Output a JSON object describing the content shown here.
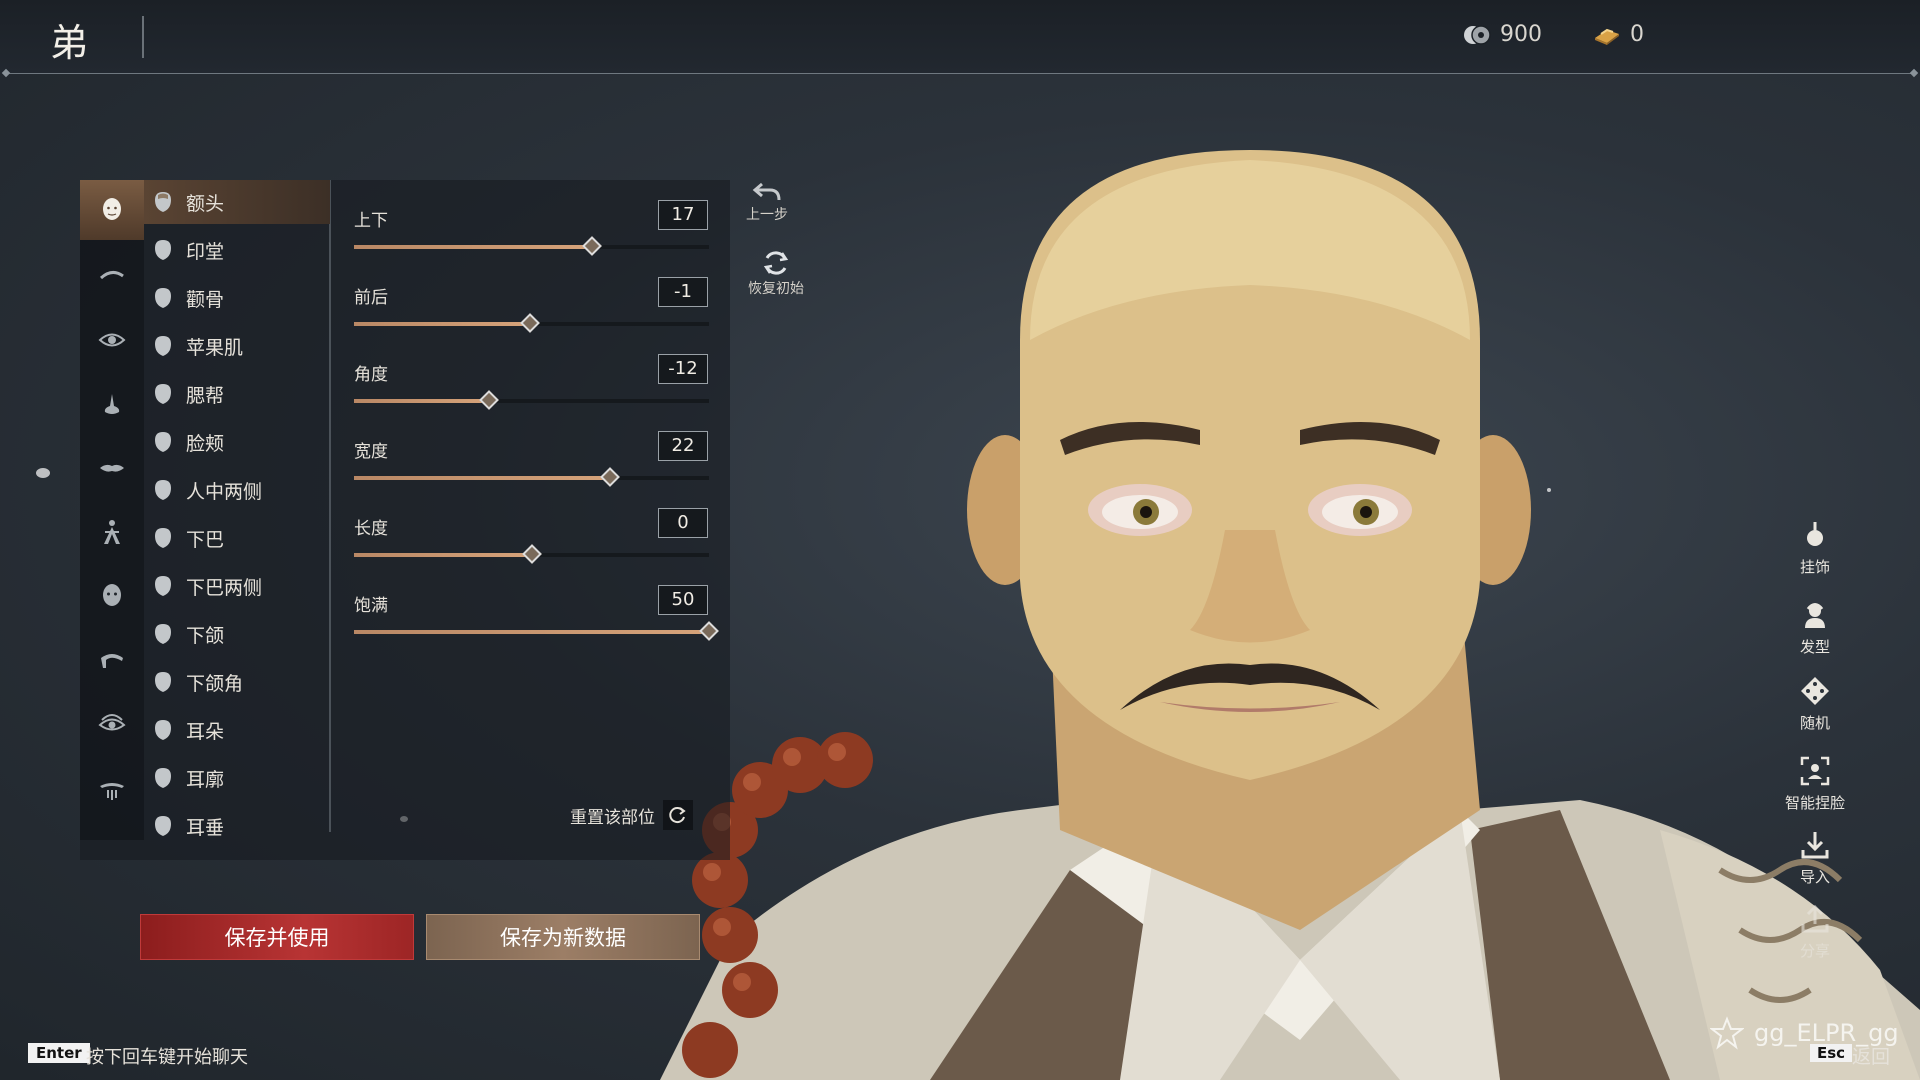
{
  "header": {
    "title": "弟",
    "currencies": [
      {
        "icon": "coin-icon",
        "value": "900"
      },
      {
        "icon": "ingot-icon",
        "value": "0"
      }
    ]
  },
  "categories": [
    {
      "icon": "face-icon",
      "active": true
    },
    {
      "icon": "brow-icon",
      "active": false
    },
    {
      "icon": "eye-icon",
      "active": false
    },
    {
      "icon": "nose-icon",
      "active": false
    },
    {
      "icon": "mouth-icon",
      "active": false
    },
    {
      "icon": "body-icon",
      "active": false
    },
    {
      "icon": "head-icon",
      "active": false
    },
    {
      "icon": "hair-icon",
      "active": false
    },
    {
      "icon": "eye-makeup-icon",
      "active": false
    },
    {
      "icon": "beard-icon",
      "active": false
    }
  ],
  "parts": [
    {
      "label": "额头",
      "active": true
    },
    {
      "label": "印堂",
      "active": false
    },
    {
      "label": "颧骨",
      "active": false
    },
    {
      "label": "苹果肌",
      "active": false
    },
    {
      "label": "腮帮",
      "active": false
    },
    {
      "label": "脸颊",
      "active": false
    },
    {
      "label": "人中两侧",
      "active": false
    },
    {
      "label": "下巴",
      "active": false
    },
    {
      "label": "下巴两侧",
      "active": false
    },
    {
      "label": "下颌",
      "active": false
    },
    {
      "label": "下颌角",
      "active": false
    },
    {
      "label": "耳朵",
      "active": false
    },
    {
      "label": "耳廓",
      "active": false
    },
    {
      "label": "耳垂",
      "active": false
    }
  ],
  "sliders": [
    {
      "label": "上下",
      "value": "17",
      "level": 0.67
    },
    {
      "label": "前后",
      "value": "-1",
      "level": 0.495
    },
    {
      "label": "角度",
      "value": "-12",
      "level": 0.38
    },
    {
      "label": "宽度",
      "value": "22",
      "level": 0.72
    },
    {
      "label": "长度",
      "value": "0",
      "level": 0.5
    },
    {
      "label": "饱满",
      "value": "50",
      "level": 1.0
    }
  ],
  "reset_part_label": "重置该部位",
  "tools": {
    "undo_label": "上一步",
    "restore_label": "恢复初始"
  },
  "buttons": {
    "save_use": "保存并使用",
    "save_new": "保存为新数据"
  },
  "right_tools": [
    {
      "icon": "pendant-icon",
      "label": "挂饰"
    },
    {
      "icon": "hairstyle-icon",
      "label": "发型"
    },
    {
      "icon": "dice-icon",
      "label": "随机"
    },
    {
      "icon": "smart-face-icon",
      "label": "智能捏脸"
    },
    {
      "icon": "import-icon",
      "label": "导入"
    },
    {
      "icon": "share-icon",
      "label": "分享"
    }
  ],
  "chat": {
    "key": "Enter",
    "hint": "按下回车键开始聊天"
  },
  "user": {
    "name": "gg_ELPR_gg"
  },
  "back": {
    "key": "Esc",
    "label": "返回"
  },
  "colors": {
    "accent": "#c8936b",
    "save_red": "#b83434",
    "save_new_brown": "#9c7e66"
  }
}
